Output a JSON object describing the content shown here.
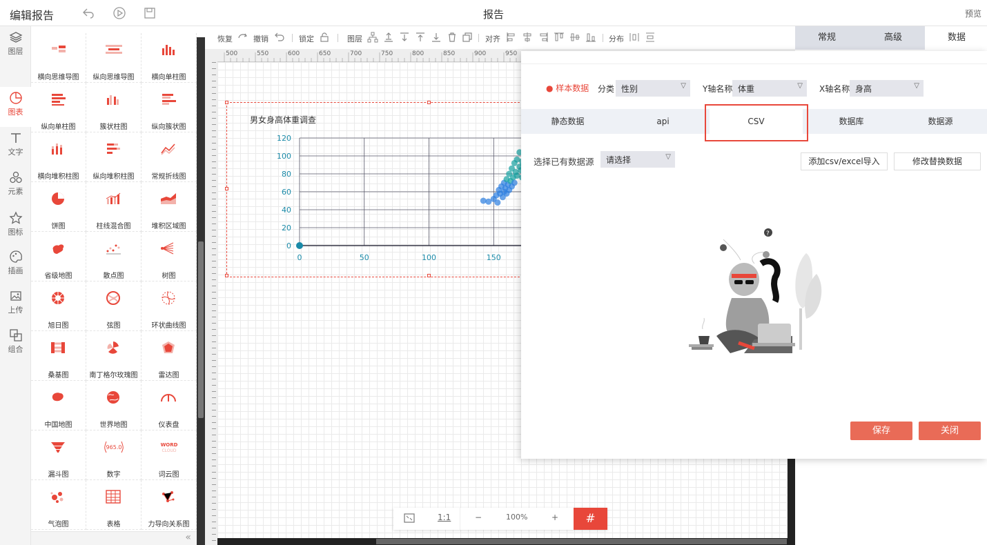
{
  "header": {
    "title": "编辑报告",
    "center_title": "报告",
    "preview": "预览"
  },
  "rail": {
    "items": [
      {
        "label": "图层",
        "icon": "layers-icon"
      },
      {
        "label": "图表",
        "icon": "chart-icon",
        "active": true
      },
      {
        "label": "文字",
        "icon": "text-icon"
      },
      {
        "label": "元素",
        "icon": "elements-icon"
      },
      {
        "label": "图标",
        "icon": "star-icon"
      },
      {
        "label": "插画",
        "icon": "palette-icon"
      },
      {
        "label": "上传",
        "icon": "upload-icon"
      },
      {
        "label": "组合",
        "icon": "group-icon"
      }
    ]
  },
  "components": [
    "横向思维导图",
    "纵向思维导图",
    "横向单柱图",
    "纵向单柱图",
    "簇状柱图",
    "纵向簇状图",
    "横向堆积柱图",
    "纵向堆积柱图",
    "常规折线图",
    "饼图",
    "柱线混合图",
    "堆积区域图",
    "省级地图",
    "散点图",
    "树图",
    "旭日图",
    "弦图",
    "环状曲线图",
    "桑基图",
    "南丁格尔玫瑰图",
    "雷达图",
    "中国地图",
    "世界地图",
    "仪表盘",
    "漏斗图",
    "数字",
    "词云图",
    "气泡图",
    "表格",
    "力导向关系图"
  ],
  "number_icon_text": "965.0",
  "wordcloud_icon_text": {
    "top": "WORD",
    "bottom": "CLOUD"
  },
  "toolbar": {
    "redo": "恢复",
    "undo": "撤销",
    "lock": "锁定",
    "layer": "图层",
    "align": "对齐",
    "distribute": "分布"
  },
  "ruler": [
    "500",
    "550",
    "600",
    "650",
    "700",
    "750",
    "800",
    "850",
    "900",
    "950"
  ],
  "chart": {
    "title": "男女身高体重调查",
    "y_ticks": [
      "120",
      "100",
      "80",
      "60",
      "40",
      "20",
      "0"
    ],
    "x_ticks": [
      "0",
      "50",
      "100",
      "150"
    ]
  },
  "chart_data": {
    "type": "scatter",
    "title": "男女身高体重调查",
    "xlabel": "",
    "ylabel": "",
    "xlim": [
      0,
      200
    ],
    "ylim": [
      0,
      120
    ],
    "grid": true,
    "series": [
      {
        "points": [
          [
            0,
            0
          ],
          [
            142,
            50
          ],
          [
            146,
            49
          ],
          [
            150,
            52
          ],
          [
            152,
            56
          ],
          [
            153,
            48
          ],
          [
            154,
            62
          ],
          [
            155,
            58
          ],
          [
            156,
            66
          ],
          [
            157,
            54
          ],
          [
            158,
            70
          ],
          [
            158,
            60
          ],
          [
            159,
            64
          ],
          [
            160,
            74
          ],
          [
            160,
            58
          ],
          [
            161,
            68
          ],
          [
            162,
            62
          ],
          [
            162,
            80
          ],
          [
            163,
            72
          ],
          [
            164,
            86
          ],
          [
            164,
            66
          ],
          [
            165,
            76
          ],
          [
            166,
            70
          ],
          [
            166,
            92
          ],
          [
            167,
            82
          ],
          [
            168,
            78
          ],
          [
            168,
            96
          ],
          [
            170,
            104
          ],
          [
            170,
            88
          ],
          [
            171,
            84
          ],
          [
            172,
            94
          ],
          [
            172,
            76
          ],
          [
            173,
            90
          ],
          [
            175,
            98
          ]
        ]
      }
    ]
  },
  "zoom": {
    "fit": "1:1",
    "minus": "−",
    "level": "100%",
    "plus": "+",
    "grid": "#"
  },
  "props_tabs": [
    "常规",
    "高级",
    "数据"
  ],
  "dialog": {
    "sample_label": "样本数据",
    "category_label": "分类",
    "category_value": "性别",
    "y_label": "Y轴名称",
    "y_value": "体重",
    "x_label": "X轴名称",
    "x_value": "身高",
    "tabs": [
      "静态数据",
      "api",
      "CSV",
      "数据库",
      "数据源"
    ],
    "choose_label": "选择已有数据源",
    "choose_placeholder": "请选择",
    "import_button": "添加csv/excel导入",
    "replace_button": "修改替换数据",
    "save_button": "保存",
    "close_button": "关闭"
  },
  "colors": {
    "accent": "#e8473a",
    "button": "#e96b57",
    "axis": "#1a8aa8",
    "scatter": "#2b7de0"
  }
}
